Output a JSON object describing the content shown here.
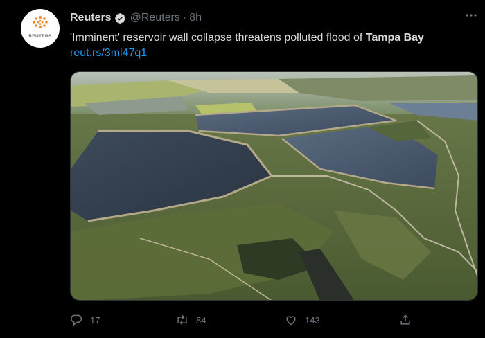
{
  "tweet": {
    "display_name": "Reuters",
    "handle": "@Reuters",
    "separator": "·",
    "time": "8h",
    "avatar_text": "REUTERS",
    "text_before": "'Imminent' reservoir wall collapse threatens polluted flood of ",
    "text_bold": "Tampa Bay",
    "link": "reut.rs/3ml47q1"
  },
  "actions": {
    "reply_count": "17",
    "retweet_count": "84",
    "like_count": "143"
  },
  "icons": [
    "verified-badge-icon",
    "more-icon",
    "reply-icon",
    "retweet-icon",
    "like-icon",
    "share-icon"
  ],
  "colors": {
    "background": "#000000",
    "text": "#d9d9d9",
    "muted": "#6e767d",
    "link": "#1d9bf0"
  }
}
